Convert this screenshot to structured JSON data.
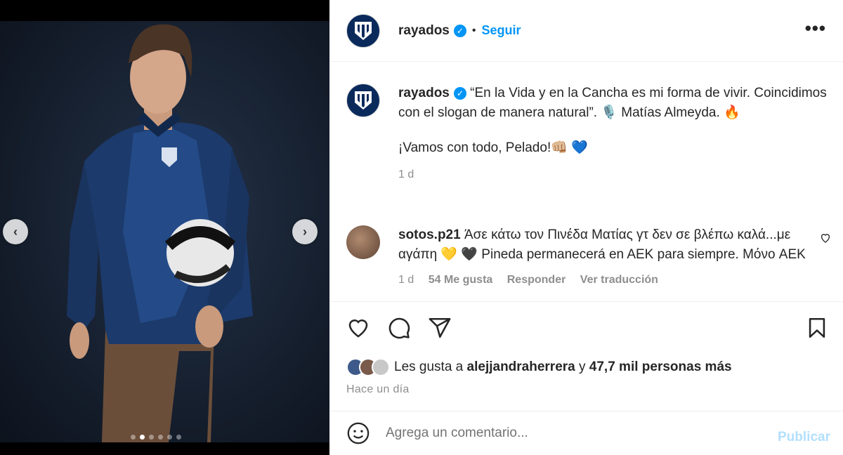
{
  "post": {
    "username": "rayados",
    "follow_label": "Seguir",
    "separator": "•",
    "more_label": "•••"
  },
  "caption": {
    "username": "rayados",
    "text": "“En la Vida y en la Cancha es mi forma de vivir. Coincidimos con el slogan de manera natural”. 🎙️ Matías Almeyda. 🔥",
    "text2": "¡Vamos con todo, Pelado!👊🏼 💙",
    "time": "1 d"
  },
  "comment": {
    "username": "sotos.p21",
    "text": "Άσε κάτω τον Πινέδα Ματίας γτ δεν σε βλέπω καλά...με αγάπη 💛 🖤 Pineda permanecerá en AEK para siempre. Μόνο AEK",
    "time": "1 d",
    "likes": "54 Me gusta",
    "reply": "Responder",
    "translate": "Ver traducción"
  },
  "likes": {
    "prefix": "Les gusta a",
    "user": "alejjandraherrera",
    "connector": "y",
    "others": "47,7 mil personas más"
  },
  "timestamp": "Hace un día",
  "add_comment": {
    "placeholder": "Agrega un comentario...",
    "publish_label": "Publicar"
  },
  "media": {
    "slides": 6,
    "active_index": 1
  },
  "icons": {
    "like": "heart-icon",
    "comment": "comment-icon",
    "share": "share-icon",
    "save": "bookmark-icon",
    "emoji": "emoji-icon",
    "verified": "verified-badge-icon"
  },
  "colors": {
    "accent": "#0095f6",
    "publish_disabled": "#b2dffc",
    "secondary_text": "#8e8e8e",
    "jacket": "#1c3a6b"
  }
}
